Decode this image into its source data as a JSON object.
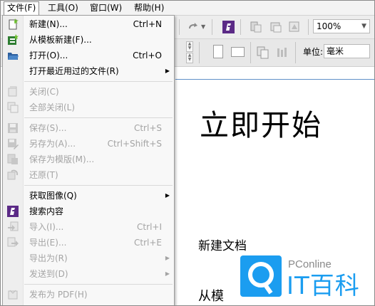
{
  "menubar": [
    {
      "label": "文件(F)",
      "active": true
    },
    {
      "label": "工具(O)",
      "active": false
    },
    {
      "label": "窗口(W)",
      "active": false
    },
    {
      "label": "帮助(H)",
      "active": false
    }
  ],
  "toolbar": {
    "zoom_value": "100%",
    "unit_label": "单位:",
    "unit_value": "毫米"
  },
  "file_menu": {
    "items": [
      {
        "label": "新建(N)...",
        "shortcut": "Ctrl+N",
        "icon": "new-document-icon",
        "enabled": true
      },
      {
        "label": "从模板新建(F)...",
        "shortcut": "",
        "icon": "new-from-template-icon",
        "enabled": true
      },
      {
        "label": "打开(O)...",
        "shortcut": "Ctrl+O",
        "icon": "open-folder-icon",
        "enabled": true
      },
      {
        "label": "打开最近用过的文件(R)",
        "shortcut": "",
        "icon": "",
        "enabled": true,
        "submenu": true
      },
      {
        "label": "关闭(C)",
        "shortcut": "",
        "icon": "close-document-icon",
        "enabled": false
      },
      {
        "label": "全部关闭(L)",
        "shortcut": "",
        "icon": "close-all-icon",
        "enabled": false
      },
      {
        "label": "保存(S)...",
        "shortcut": "Ctrl+S",
        "icon": "save-icon",
        "enabled": false
      },
      {
        "label": "另存为(A)...",
        "shortcut": "Ctrl+Shift+S",
        "icon": "save-as-icon",
        "enabled": false
      },
      {
        "label": "保存为模版(M)...",
        "shortcut": "",
        "icon": "save-as-template-icon",
        "enabled": false
      },
      {
        "label": "还原(T)",
        "shortcut": "",
        "icon": "revert-icon",
        "enabled": false
      },
      {
        "label": "获取图像(Q)",
        "shortcut": "",
        "icon": "",
        "enabled": true,
        "submenu": true
      },
      {
        "label": "搜索内容",
        "shortcut": "",
        "icon": "search-content-icon",
        "enabled": true
      },
      {
        "label": "导入(I)...",
        "shortcut": "Ctrl+I",
        "icon": "import-icon",
        "enabled": false
      },
      {
        "label": "导出(E)...",
        "shortcut": "Ctrl+E",
        "icon": "export-icon",
        "enabled": false
      },
      {
        "label": "导出为(R)",
        "shortcut": "",
        "icon": "",
        "enabled": false,
        "submenu": true
      },
      {
        "label": "发送到(D)",
        "shortcut": "",
        "icon": "",
        "enabled": false,
        "submenu": true
      },
      {
        "label": "发布为 PDF(H)",
        "shortcut": "",
        "icon": "publish-pdf-icon",
        "enabled": false
      }
    ]
  },
  "document": {
    "heading": "立即开始",
    "new_doc": "新建文档",
    "from_template": "从模"
  },
  "watermark": {
    "brand": "PConline",
    "name": "IT百科"
  },
  "colors": {
    "accent_purple": "#5b2a86",
    "watermark_blue": "#1b9df0"
  }
}
